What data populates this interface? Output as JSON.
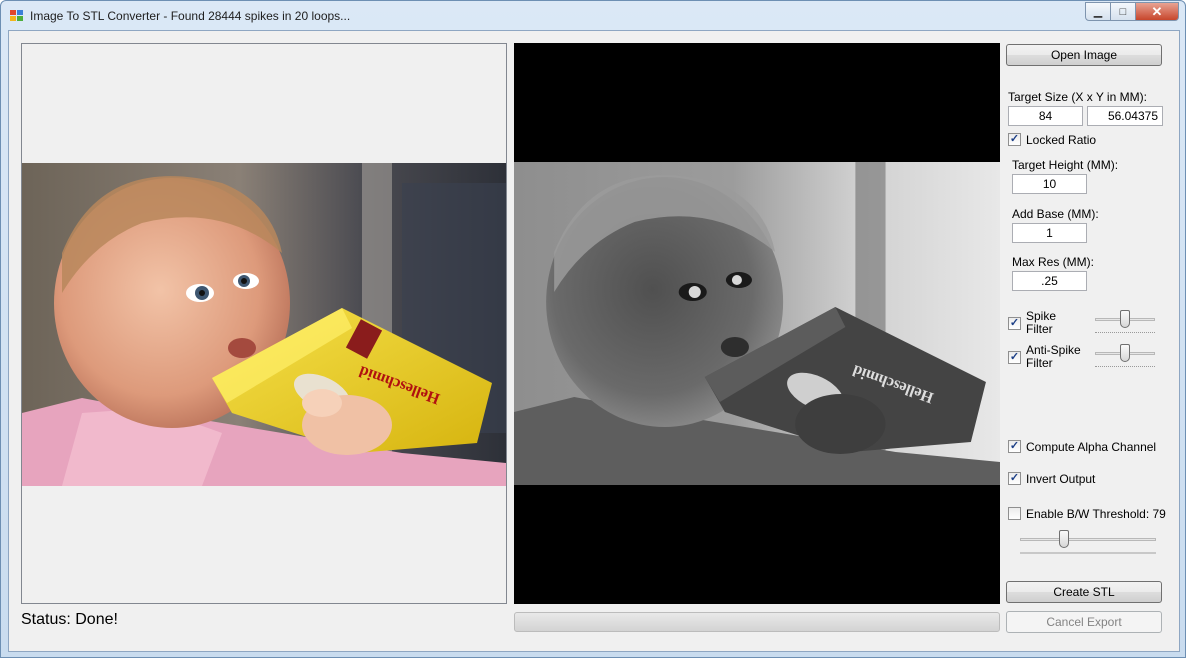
{
  "window": {
    "title": "Image To STL Converter - Found 28444 spikes in 20 loops...",
    "minimize_glyph": "▁",
    "maximize_glyph": "□",
    "close_glyph": "✕"
  },
  "controls": {
    "open_image_label": "Open Image",
    "target_size_label": "Target Size (X x Y in MM):",
    "target_x": "84",
    "target_y": "56.04375",
    "locked_ratio_label": "Locked Ratio",
    "locked_ratio_checked": true,
    "target_height_label": "Target Height (MM):",
    "target_height": "10",
    "add_base_label": "Add Base (MM):",
    "add_base": "1",
    "max_res_label": "Max Res (MM):",
    "max_res": ".25",
    "spike_filter_label_1": "Spike",
    "spike_filter_label_2": "Filter",
    "spike_filter_checked": true,
    "spike_filter_level": 0.5,
    "anti_spike_label_1": "Anti-Spike",
    "anti_spike_label_2": "Filter",
    "anti_spike_checked": true,
    "anti_spike_level": 0.5,
    "compute_alpha_label": "Compute Alpha Channel",
    "compute_alpha_checked": true,
    "invert_output_label": "Invert Output",
    "invert_output_checked": true,
    "bw_threshold_label": "Enable B/W Threshold: 79",
    "bw_threshold_checked": false,
    "bw_threshold_level": 0.31,
    "create_stl_label": "Create STL",
    "cancel_export_label": "Cancel Export"
  },
  "status": {
    "text": "Status:  Done!",
    "progress_fraction": 0
  },
  "icons": {
    "app": "app-icon",
    "check": "✓"
  },
  "colors": {
    "accent": "#3c7fb1",
    "panel_bg": "#f0f0f0"
  }
}
